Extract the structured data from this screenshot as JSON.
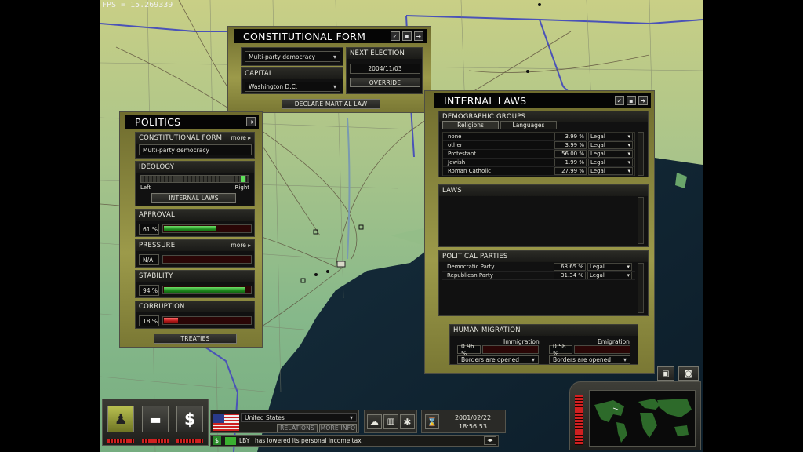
{
  "fps": "FPS = 15.269339",
  "constitutional": {
    "title": "CONSTITUTIONAL FORM",
    "form_value": "Multi-party democracy",
    "capital_label": "CAPITAL",
    "capital_value": "Washington D.C.",
    "next_election_label": "NEXT ELECTION",
    "next_election_value": "2004/11/03",
    "override_label": "OVERRIDE",
    "martial_law_label": "DECLARE MARTIAL LAW"
  },
  "politics": {
    "title": "POLITICS",
    "constitutional_label": "CONSTITUTIONAL FORM",
    "more_label": "more ▸",
    "constitutional_value": "Multi-party democracy",
    "ideology_label": "IDEOLOGY",
    "ideology_left": "Left",
    "ideology_right": "Right",
    "ideology_position": 0.97,
    "internal_laws_label": "INTERNAL LAWS",
    "approval_label": "APPROVAL",
    "approval_value": "61 %",
    "approval_fraction": 0.61,
    "pressure_label": "PRESSURE",
    "pressure_value": "N/A",
    "stability_label": "STABILITY",
    "stability_value": "94 %",
    "stability_fraction": 0.94,
    "corruption_label": "CORRUPTION",
    "corruption_value": "18 %",
    "corruption_fraction": 0.18,
    "treaties_label": "TREATIES"
  },
  "internal_laws": {
    "title": "INTERNAL LAWS",
    "demographic_label": "DEMOGRAPHIC GROUPS",
    "tab_religions": "Religions",
    "tab_languages": "Languages",
    "religions": [
      {
        "name": "none",
        "pct": "3.99 %",
        "status": "Legal"
      },
      {
        "name": "other",
        "pct": "3.99 %",
        "status": "Legal"
      },
      {
        "name": "Protestant",
        "pct": "56.00 %",
        "status": "Legal"
      },
      {
        "name": "Jewish",
        "pct": "1.99 %",
        "status": "Legal"
      },
      {
        "name": "Roman Catholic",
        "pct": "27.99 %",
        "status": "Legal"
      }
    ],
    "laws_label": "LAWS",
    "parties_label": "POLITICAL PARTIES",
    "parties": [
      {
        "name": "Democratic Party",
        "pct": "68.65 %",
        "status": "Legal"
      },
      {
        "name": "Republican Party",
        "pct": "31.34 %",
        "status": "Legal"
      }
    ],
    "migration_label": "HUMAN MIGRATION",
    "immigration_label": "Immigration",
    "immigration_value": "0.96 %",
    "immigration_policy": "Borders are opened",
    "emigration_label": "Emigration",
    "emigration_value": "0.58 %",
    "emigration_policy": "Borders are opened"
  },
  "bottom": {
    "country": "United States",
    "relations_label": "RELATIONS",
    "more_info_label": "MORE INFO",
    "date": "2001/02/22",
    "time": "18:56:53",
    "ticker_country": "LBY",
    "ticker_text": "has lowered its personal income tax"
  },
  "colors": {
    "panel_olive": "#9c9a4a",
    "bar_green": "#1f8a1e",
    "bar_red": "#b11616"
  }
}
